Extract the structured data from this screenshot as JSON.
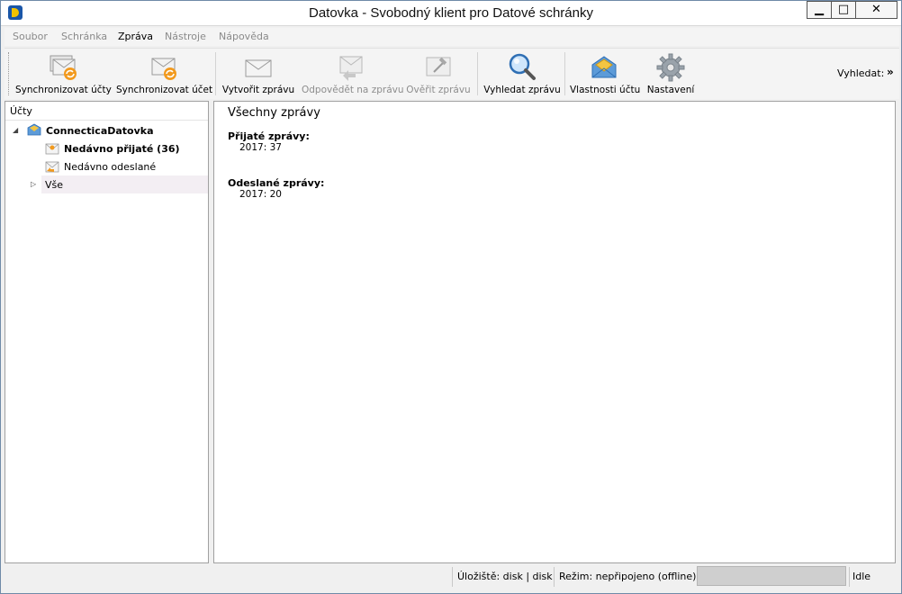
{
  "window": {
    "title": "Datovka - Svobodný klient pro Datové schránky",
    "minimize_symbol": "▁",
    "maximize_symbol": "□",
    "close_symbol": "✕"
  },
  "menu": [
    {
      "label": "Soubor",
      "enabled": false
    },
    {
      "label": "Schránka",
      "enabled": false
    },
    {
      "label": "Zpráva",
      "enabled": true
    },
    {
      "label": "Nástroje",
      "enabled": false
    },
    {
      "label": "Nápověda",
      "enabled": false
    }
  ],
  "toolbar": {
    "buttons": [
      {
        "label": "Synchronizovat účty",
        "icon": "sync-all-icon",
        "enabled": true
      },
      {
        "label": "Synchronizovat účet",
        "icon": "sync-icon",
        "enabled": true
      },
      {
        "label": "Vytvořit zprávu",
        "icon": "envelope-icon",
        "enabled": true
      },
      {
        "label": "Odpovědět na zprávu",
        "icon": "reply-icon",
        "enabled": false
      },
      {
        "label": "Ověřit zprávu",
        "icon": "verify-icon",
        "enabled": false
      },
      {
        "label": "Vyhledat zprávu",
        "icon": "search-icon",
        "enabled": true
      },
      {
        "label": "Vlastnosti účtu",
        "icon": "account-icon",
        "enabled": true
      },
      {
        "label": "Nastavení",
        "icon": "gear-icon",
        "enabled": true
      }
    ],
    "search_label": "Vyhledat:",
    "overflow_symbol": "»"
  },
  "accounts": {
    "header": "Účty",
    "account_name": "ConnecticaDatovka",
    "items": [
      {
        "label": "Nedávno přijaté (36)",
        "bold": true
      },
      {
        "label": "Nedávno odeslané",
        "bold": false
      },
      {
        "label": "Vše",
        "bold": false
      }
    ]
  },
  "overview": {
    "title": "Všechny zprávy",
    "received_heading": "Přijaté zprávy:",
    "received_value": "2017: 37",
    "sent_heading": "Odeslané zprávy:",
    "sent_value": "2017: 20"
  },
  "status": {
    "storage": "Úložiště: disk | disk",
    "mode": "Režim: nepřipojeno (offline)",
    "state": "Idle"
  }
}
